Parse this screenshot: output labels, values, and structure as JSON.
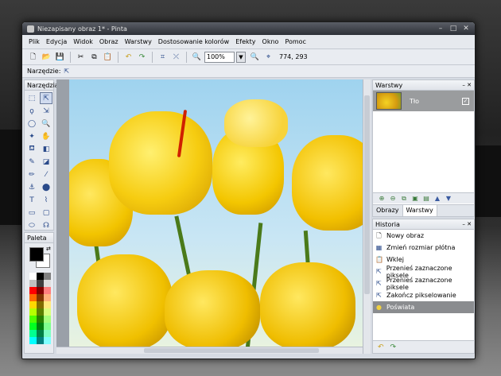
{
  "window": {
    "title": "Niezapisany obraz 1* - Pinta"
  },
  "menu": [
    "Plik",
    "Edycja",
    "Widok",
    "Obraz",
    "Warstwy",
    "Dostosowanie kolorów",
    "Efekty",
    "Okno",
    "Pomoc"
  ],
  "toolbar": {
    "zoom": "100%",
    "coords": "774, 293"
  },
  "toolrow": {
    "label": "Narzędzie:"
  },
  "panels": {
    "tools": "Narzędzia",
    "palette": "Paleta",
    "layers": "Warstwy",
    "history": "Historia"
  },
  "layers": {
    "items": [
      {
        "name": "Tło",
        "visible": true
      }
    ],
    "tabs": [
      "Obrazy",
      "Warstwy"
    ]
  },
  "history": {
    "items": [
      "Nowy obraz",
      "Zmień rozmiar płótna",
      "Wklej",
      "Przenieś zaznaczone piksele",
      "Przenieś zaznaczone piksele",
      "Zakończ pikselowanie",
      "Poświata"
    ],
    "selected": 6
  },
  "colors": {
    "primary": "#000000",
    "secondary": "#ffffff",
    "accent": "#d0dbef"
  }
}
